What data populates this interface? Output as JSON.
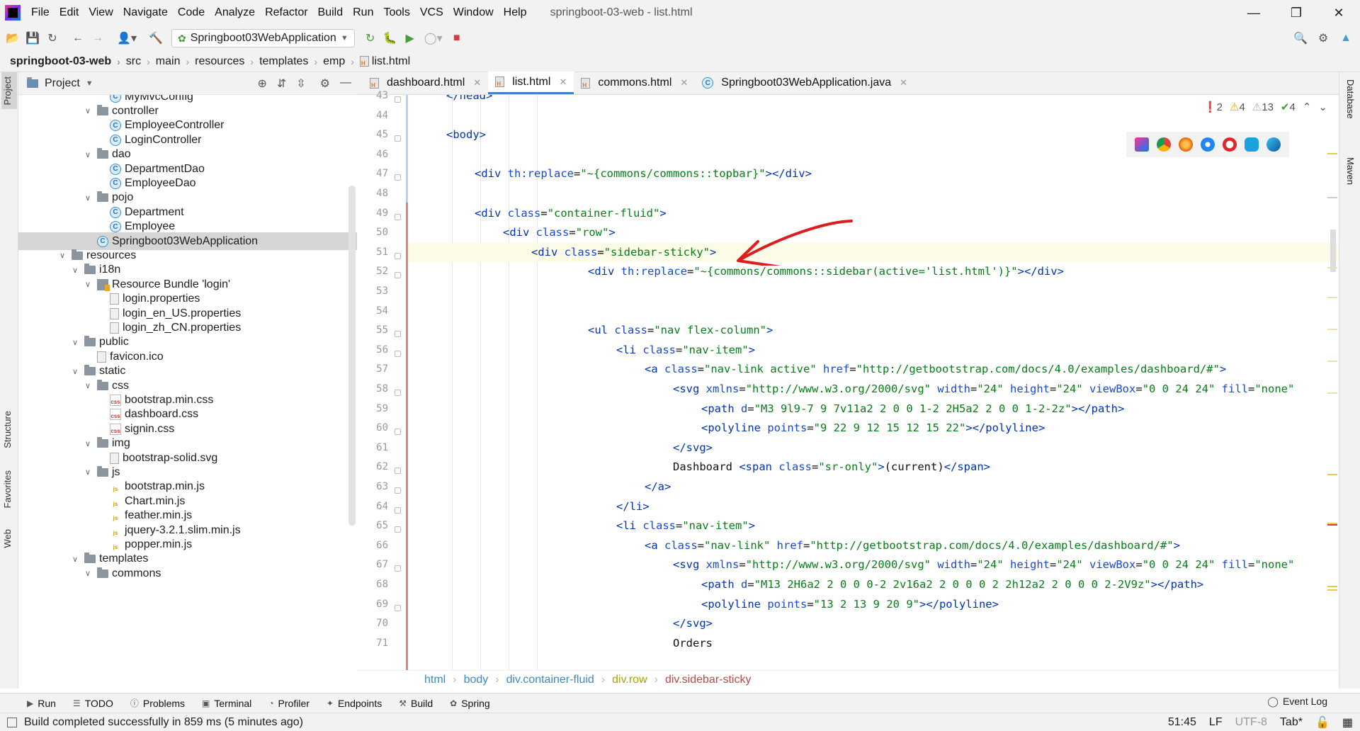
{
  "menubar": {
    "items": [
      "File",
      "Edit",
      "View",
      "Navigate",
      "Code",
      "Analyze",
      "Refactor",
      "Build",
      "Run",
      "Tools",
      "VCS",
      "Window",
      "Help"
    ],
    "title": "springboot-03-web - list.html"
  },
  "toolbar": {
    "run_config": "Springboot03WebApplication"
  },
  "breadcrumb": [
    "springboot-03-web",
    "src",
    "main",
    "resources",
    "templates",
    "emp",
    "list.html"
  ],
  "left_strip": {
    "project": "Project",
    "structure": "Structure",
    "favorites": "Favorites",
    "web": "Web"
  },
  "project_panel": {
    "title": "Project",
    "tree": [
      {
        "label": "MyMvcConfig",
        "type": "class",
        "indent": 3
      },
      {
        "label": "controller",
        "type": "folder",
        "indent": 2,
        "expanded": true
      },
      {
        "label": "EmployeeController",
        "type": "class",
        "indent": 3
      },
      {
        "label": "LoginController",
        "type": "class",
        "indent": 3
      },
      {
        "label": "dao",
        "type": "folder",
        "indent": 2,
        "expanded": true
      },
      {
        "label": "DepartmentDao",
        "type": "class",
        "indent": 3
      },
      {
        "label": "EmployeeDao",
        "type": "class",
        "indent": 3
      },
      {
        "label": "pojo",
        "type": "folder",
        "indent": 2,
        "expanded": true
      },
      {
        "label": "Department",
        "type": "class",
        "indent": 3
      },
      {
        "label": "Employee",
        "type": "class",
        "indent": 3
      },
      {
        "label": "Springboot03WebApplication",
        "type": "class",
        "indent": 2,
        "selected": true
      },
      {
        "label": "resources",
        "type": "folder",
        "indent": 0,
        "expanded": true
      },
      {
        "label": "i18n",
        "type": "folder",
        "indent": 1,
        "expanded": true
      },
      {
        "label": "Resource Bundle 'login'",
        "type": "bundle",
        "indent": 2,
        "expanded": true
      },
      {
        "label": "login.properties",
        "type": "file",
        "indent": 3
      },
      {
        "label": "login_en_US.properties",
        "type": "file",
        "indent": 3
      },
      {
        "label": "login_zh_CN.properties",
        "type": "file",
        "indent": 3
      },
      {
        "label": "public",
        "type": "folder",
        "indent": 1,
        "expanded": true
      },
      {
        "label": "favicon.ico",
        "type": "file",
        "indent": 2
      },
      {
        "label": "static",
        "type": "folder",
        "indent": 1,
        "expanded": true
      },
      {
        "label": "css",
        "type": "folder",
        "indent": 2,
        "expanded": true
      },
      {
        "label": "bootstrap.min.css",
        "type": "css",
        "indent": 3
      },
      {
        "label": "dashboard.css",
        "type": "css",
        "indent": 3
      },
      {
        "label": "signin.css",
        "type": "css",
        "indent": 3
      },
      {
        "label": "img",
        "type": "folder",
        "indent": 2,
        "expanded": true
      },
      {
        "label": "bootstrap-solid.svg",
        "type": "file",
        "indent": 3
      },
      {
        "label": "js",
        "type": "folder",
        "indent": 2,
        "expanded": true
      },
      {
        "label": "bootstrap.min.js",
        "type": "js",
        "indent": 3
      },
      {
        "label": "Chart.min.js",
        "type": "js",
        "indent": 3
      },
      {
        "label": "feather.min.js",
        "type": "js",
        "indent": 3
      },
      {
        "label": "jquery-3.2.1.slim.min.js",
        "type": "js",
        "indent": 3
      },
      {
        "label": "popper.min.js",
        "type": "js",
        "indent": 3
      },
      {
        "label": "templates",
        "type": "folder",
        "indent": 1,
        "expanded": true
      },
      {
        "label": "commons",
        "type": "folder",
        "indent": 2,
        "expanded": true
      }
    ]
  },
  "tabs": [
    {
      "label": "dashboard.html",
      "type": "html"
    },
    {
      "label": "list.html",
      "type": "html",
      "active": true
    },
    {
      "label": "commons.html",
      "type": "html"
    },
    {
      "label": "Springboot03WebApplication.java",
      "type": "class"
    }
  ],
  "inspections": {
    "errors": "2",
    "warnings": "4",
    "weak": "13",
    "ok": "4"
  },
  "code": {
    "lines": [
      {
        "n": "43",
        "indent": 1,
        "segs": [
          [
            "tag",
            "</head>"
          ]
        ]
      },
      {
        "n": "44",
        "indent": 0,
        "segs": []
      },
      {
        "n": "45",
        "indent": 1,
        "segs": [
          [
            "tag",
            "<body>"
          ]
        ]
      },
      {
        "n": "46",
        "indent": 0,
        "segs": []
      },
      {
        "n": "47",
        "indent": 2,
        "segs": [
          [
            "tag",
            "<div "
          ],
          [
            "att",
            "th:replace"
          ],
          [
            "",
            "="
          ],
          [
            "str",
            "\"~{commons/commons::topbar}\""
          ],
          [
            "tag",
            "></div>"
          ]
        ]
      },
      {
        "n": "48",
        "indent": 0,
        "segs": []
      },
      {
        "n": "49",
        "indent": 2,
        "segs": [
          [
            "tag",
            "<div "
          ],
          [
            "att",
            "class"
          ],
          [
            "",
            "="
          ],
          [
            "str",
            "\"container-fluid\""
          ],
          [
            "tag",
            ">"
          ]
        ]
      },
      {
        "n": "50",
        "indent": 3,
        "segs": [
          [
            "tag",
            "<div "
          ],
          [
            "att",
            "class"
          ],
          [
            "",
            "="
          ],
          [
            "str",
            "\"row\""
          ],
          [
            "tag",
            ">"
          ]
        ]
      },
      {
        "n": "51",
        "indent": 4,
        "cur": true,
        "segs": [
          [
            "tag",
            "<div "
          ],
          [
            "att",
            "class"
          ],
          [
            "",
            "="
          ],
          [
            "str",
            "\"sidebar-sticky\""
          ],
          [
            "tag",
            ">"
          ]
        ]
      },
      {
        "n": "52",
        "indent": 6,
        "segs": [
          [
            "tag",
            "<div "
          ],
          [
            "att",
            "th:replace"
          ],
          [
            "",
            "="
          ],
          [
            "str",
            "\"~{commons/commons::sidebar(active='list.html')}\""
          ],
          [
            "tag",
            "></div>"
          ]
        ]
      },
      {
        "n": "53",
        "indent": 0,
        "segs": []
      },
      {
        "n": "54",
        "indent": 0,
        "segs": []
      },
      {
        "n": "55",
        "indent": 6,
        "segs": [
          [
            "tag",
            "<ul "
          ],
          [
            "att",
            "class"
          ],
          [
            "",
            "="
          ],
          [
            "str",
            "\"nav flex-column\""
          ],
          [
            "tag",
            ">"
          ]
        ]
      },
      {
        "n": "56",
        "indent": 7,
        "segs": [
          [
            "tag",
            "<li "
          ],
          [
            "att",
            "class"
          ],
          [
            "",
            "="
          ],
          [
            "str",
            "\"nav-item\""
          ],
          [
            "tag",
            ">"
          ]
        ]
      },
      {
        "n": "57",
        "indent": 8,
        "segs": [
          [
            "tag",
            "<a "
          ],
          [
            "att",
            "class"
          ],
          [
            "",
            "="
          ],
          [
            "str",
            "\"nav-link active\" "
          ],
          [
            "att",
            "href"
          ],
          [
            "",
            "="
          ],
          [
            "str",
            "\"http://getbootstrap.com/docs/4.0/examples/dashboard/#\""
          ],
          [
            "tag",
            ">"
          ]
        ]
      },
      {
        "n": "58",
        "indent": 9,
        "segs": [
          [
            "tag",
            "<svg "
          ],
          [
            "att",
            "xmlns"
          ],
          [
            "",
            "="
          ],
          [
            "str",
            "\"http://www.w3.org/2000/svg\" "
          ],
          [
            "att",
            "width"
          ],
          [
            "",
            "="
          ],
          [
            "str",
            "\"24\" "
          ],
          [
            "att",
            "height"
          ],
          [
            "",
            "="
          ],
          [
            "str",
            "\"24\" "
          ],
          [
            "att",
            "viewBox"
          ],
          [
            "",
            "="
          ],
          [
            "str",
            "\"0 0 24 24\" "
          ],
          [
            "att",
            "fill"
          ],
          [
            "",
            "="
          ],
          [
            "str",
            "\"none\""
          ]
        ]
      },
      {
        "n": "59",
        "indent": 10,
        "segs": [
          [
            "tag",
            "<path "
          ],
          [
            "att",
            "d"
          ],
          [
            "",
            "="
          ],
          [
            "str",
            "\"M3 9l9-7 9 7v11a2 2 0 0 1-2 2H5a2 2 0 0 1-2-2z\""
          ],
          [
            "tag",
            "></path>"
          ]
        ]
      },
      {
        "n": "60",
        "indent": 10,
        "segs": [
          [
            "tag",
            "<polyline "
          ],
          [
            "att",
            "points"
          ],
          [
            "",
            "="
          ],
          [
            "str",
            "\"9 22 9 12 15 12 15 22\""
          ],
          [
            "tag",
            "></polyline>"
          ]
        ]
      },
      {
        "n": "61",
        "indent": 9,
        "segs": [
          [
            "tag",
            "</svg>"
          ]
        ]
      },
      {
        "n": "62",
        "indent": 9,
        "segs": [
          [
            "",
            "Dashboard "
          ],
          [
            "tag",
            "<span "
          ],
          [
            "att",
            "class"
          ],
          [
            "",
            "="
          ],
          [
            "str",
            "\"sr-only\""
          ],
          [
            "tag",
            ">"
          ],
          [
            "",
            "(current)"
          ],
          [
            "tag",
            "</span>"
          ]
        ]
      },
      {
        "n": "63",
        "indent": 8,
        "segs": [
          [
            "tag",
            "</a>"
          ]
        ]
      },
      {
        "n": "64",
        "indent": 7,
        "segs": [
          [
            "tag",
            "</li>"
          ]
        ]
      },
      {
        "n": "65",
        "indent": 7,
        "segs": [
          [
            "tag",
            "<li "
          ],
          [
            "att",
            "class"
          ],
          [
            "",
            "="
          ],
          [
            "str",
            "\"nav-item\""
          ],
          [
            "tag",
            ">"
          ]
        ]
      },
      {
        "n": "66",
        "indent": 8,
        "segs": [
          [
            "tag",
            "<a "
          ],
          [
            "att",
            "class"
          ],
          [
            "",
            "="
          ],
          [
            "str",
            "\"nav-link\" "
          ],
          [
            "att",
            "href"
          ],
          [
            "",
            "="
          ],
          [
            "str",
            "\"http://getbootstrap.com/docs/4.0/examples/dashboard/#\""
          ],
          [
            "tag",
            ">"
          ]
        ]
      },
      {
        "n": "67",
        "indent": 9,
        "segs": [
          [
            "tag",
            "<svg "
          ],
          [
            "att",
            "xmlns"
          ],
          [
            "",
            "="
          ],
          [
            "str",
            "\"http://www.w3.org/2000/svg\" "
          ],
          [
            "att",
            "width"
          ],
          [
            "",
            "="
          ],
          [
            "str",
            "\"24\" "
          ],
          [
            "att",
            "height"
          ],
          [
            "",
            "="
          ],
          [
            "str",
            "\"24\" "
          ],
          [
            "att",
            "viewBox"
          ],
          [
            "",
            "="
          ],
          [
            "str",
            "\"0 0 24 24\" "
          ],
          [
            "att",
            "fill"
          ],
          [
            "",
            "="
          ],
          [
            "str",
            "\"none\""
          ]
        ]
      },
      {
        "n": "68",
        "indent": 10,
        "segs": [
          [
            "tag",
            "<path "
          ],
          [
            "att",
            "d"
          ],
          [
            "",
            "="
          ],
          [
            "str",
            "\"M13 2H6a2 2 0 0 0-2 2v16a2 2 0 0 0 2 2h12a2 2 0 0 0 2-2V9z\""
          ],
          [
            "tag",
            "></path>"
          ]
        ]
      },
      {
        "n": "69",
        "indent": 10,
        "segs": [
          [
            "tag",
            "<polyline "
          ],
          [
            "att",
            "points"
          ],
          [
            "",
            "="
          ],
          [
            "str",
            "\"13 2 13 9 20 9\""
          ],
          [
            "tag",
            "></polyline>"
          ]
        ]
      },
      {
        "n": "70",
        "indent": 9,
        "segs": [
          [
            "tag",
            "</svg>"
          ]
        ]
      },
      {
        "n": "71",
        "indent": 9,
        "segs": [
          [
            "",
            "Orders"
          ]
        ]
      }
    ]
  },
  "code_breadcrumb": [
    "html",
    "body",
    "div.container-fluid",
    "div.row",
    "div.sidebar-sticky"
  ],
  "right_strip": {
    "database": "Database",
    "maven": "Maven"
  },
  "bottom_tools": [
    "Run",
    "TODO",
    "Problems",
    "Terminal",
    "Profiler",
    "Endpoints",
    "Build",
    "Spring"
  ],
  "event_log": "Event Log",
  "status": {
    "message": "Build completed successfully in 859 ms (5 minutes ago)",
    "position": "51:45",
    "line_sep": "LF",
    "encoding": "UTF-8",
    "indent": "Tab*"
  },
  "colors": {
    "annotation_arrow": "#e01b1b",
    "accent": "#4083c9"
  }
}
